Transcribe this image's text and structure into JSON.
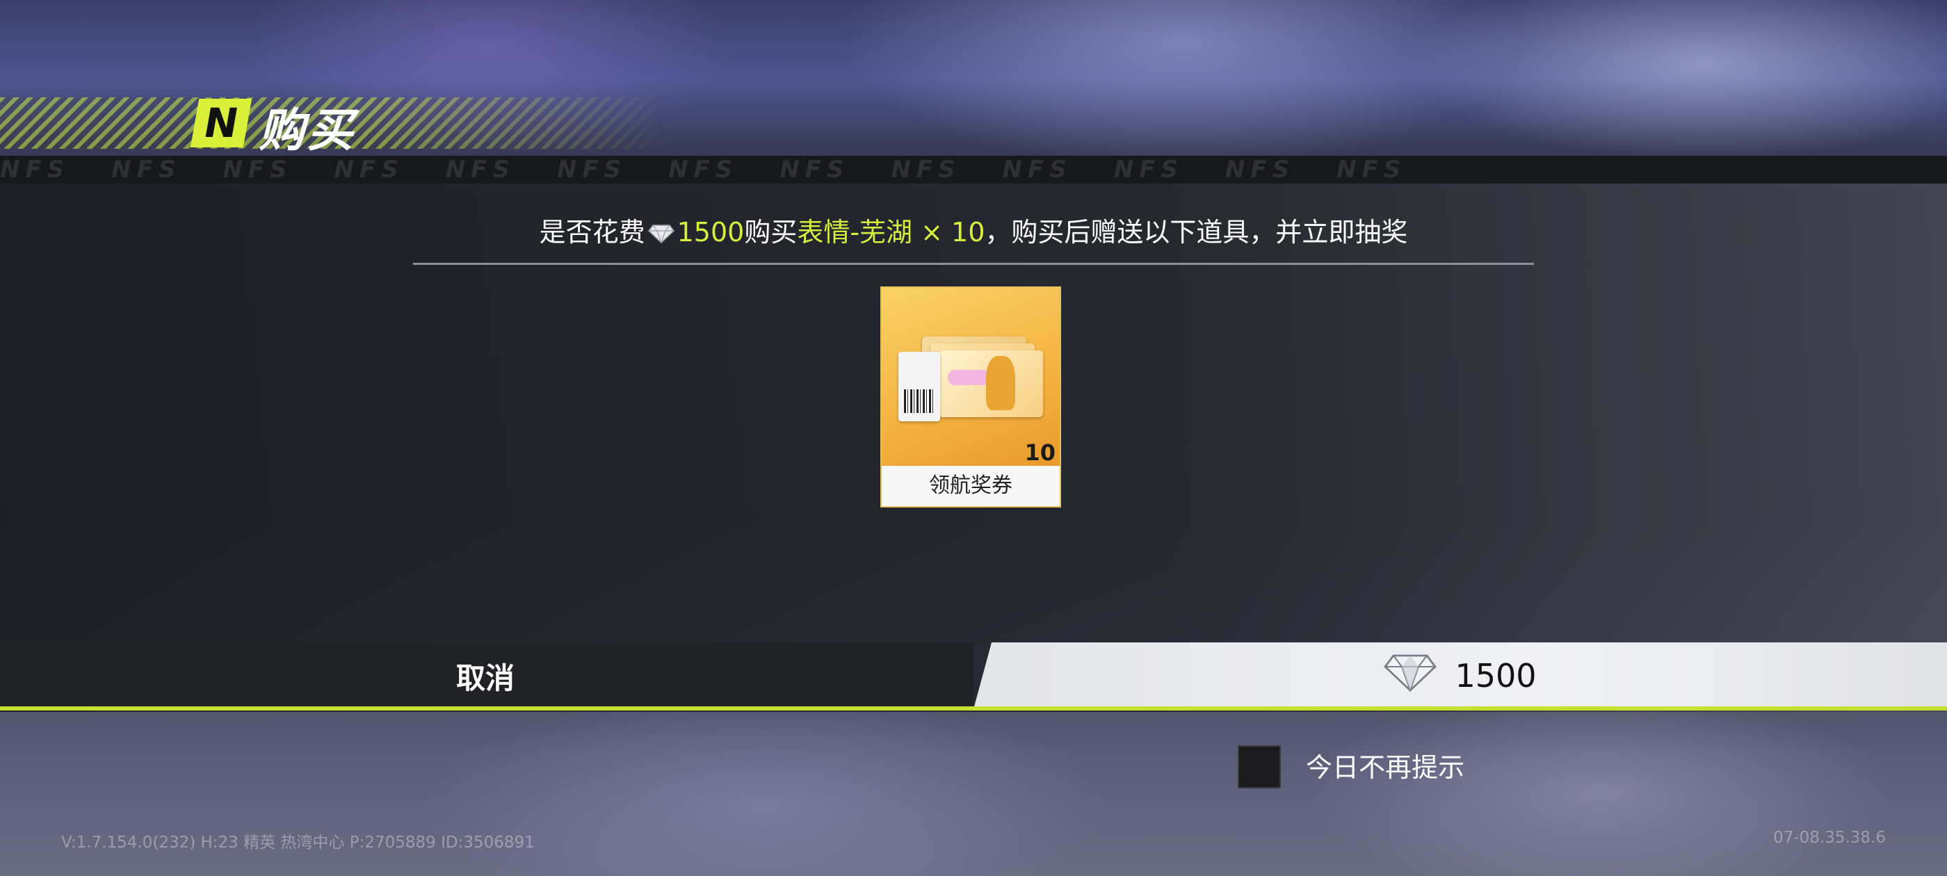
{
  "header": {
    "logo_letter": "N",
    "title": "购买"
  },
  "band": {
    "text": "NFS"
  },
  "dialog": {
    "question_prefix": "是否花费",
    "question_price": "1500",
    "question_buy": "购买",
    "question_item": "表情-芜湖 × 10",
    "question_suffix": "，购买后赠送以下道具，并立即抽奖"
  },
  "reward_item": {
    "name": "领航奖券",
    "count": "10"
  },
  "checkbox": {
    "label": "今日不再提示",
    "checked": false
  },
  "buttons": {
    "cancel_label": "取消",
    "confirm_price": "1500"
  },
  "footer": {
    "version_info": "V:1.7.154.0(232) H:23 精英 热湾中心 P:2705889 ID:3506891",
    "timestamp": "07-08.35.38.6"
  },
  "colors": {
    "accent": "#c6e032",
    "highlight_text": "#d7ef3c"
  },
  "icons": [
    "diamond-icon",
    "nfs-logo-icon",
    "ticket-icon"
  ]
}
